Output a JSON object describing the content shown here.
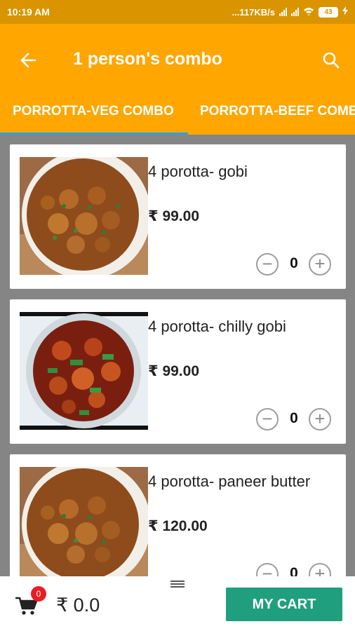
{
  "status_bar": {
    "time": "10:19 AM",
    "network_speed": "...117KB/s",
    "battery": "43"
  },
  "header": {
    "title": "1 person's combo",
    "back_icon": "arrow-left-icon",
    "search_icon": "search-icon"
  },
  "tabs": [
    {
      "label": "PORROTTA-VEG COMBO"
    },
    {
      "label": "PORROTTA-BEEF COMBO"
    }
  ],
  "items": [
    {
      "name": "4 porotta- gobi",
      "price": "₹ 99.00",
      "qty": "0",
      "image": "gobi-manchurian-photo"
    },
    {
      "name": "4 porotta- chilly gobi",
      "price": "₹ 99.00",
      "qty": "0",
      "image": "chilly-gobi-photo"
    },
    {
      "name": "4 porotta- paneer butter",
      "price": "₹ 120.00",
      "qty": "0",
      "image": "paneer-butter-photo"
    }
  ],
  "cart": {
    "badge_count": "0",
    "total": "₹ 0.0",
    "button_label": "MY CART",
    "icon": "cart-icon"
  },
  "colors": {
    "app_bar": "#ffa600",
    "status_bar": "#d99400",
    "tab_indicator": "#2aa4d8",
    "cart_button": "#1f9f7d",
    "badge": "#e81e25"
  }
}
